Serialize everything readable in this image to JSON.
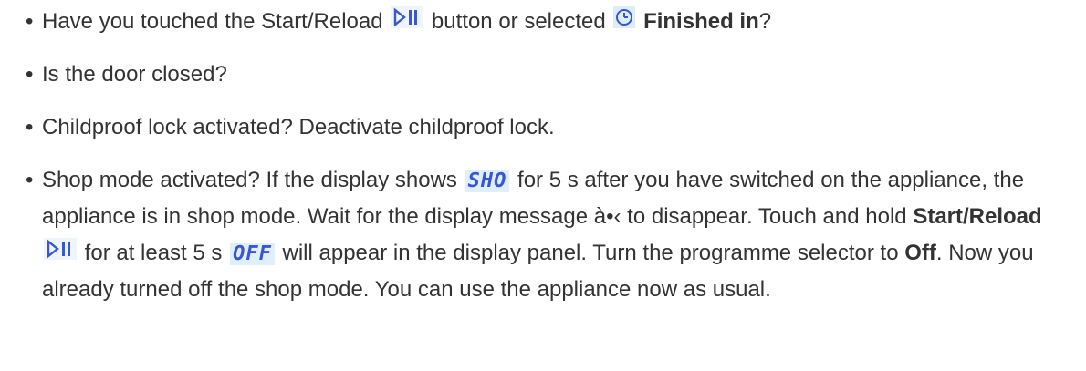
{
  "bullet": "•",
  "icons": {
    "start_reload": "start-reload-icon",
    "clock": "clock-icon"
  },
  "colors": {
    "text": "#333333",
    "display_text": "#3b56d4",
    "icon_background": "#dff0fc"
  },
  "items": [
    {
      "t1": "Have you touched the Start/Reload",
      "t2": "button or selected",
      "bold": "Finished in",
      "t3": "?"
    },
    {
      "t1": "Is the door closed?"
    },
    {
      "t1": "Childproof lock activated? Deactivate childproof lock."
    },
    {
      "t1": "Shop mode activated? If the display shows",
      "display_sho": "SHO",
      "t2": "for 5 s after you have switched on the appliance, the appliance is in shop mode. Wait for the display message à•‹ to disappear. Touch and hold",
      "bold_start": "Start/Reload",
      "t3": "for at least 5 s",
      "display_off": "OFF",
      "t4": "will appear in the display panel. Turn the programme selector to",
      "bold_off": "Off",
      "t5": ". Now you already turned off the shop mode. You can use the appliance now as usual."
    }
  ]
}
